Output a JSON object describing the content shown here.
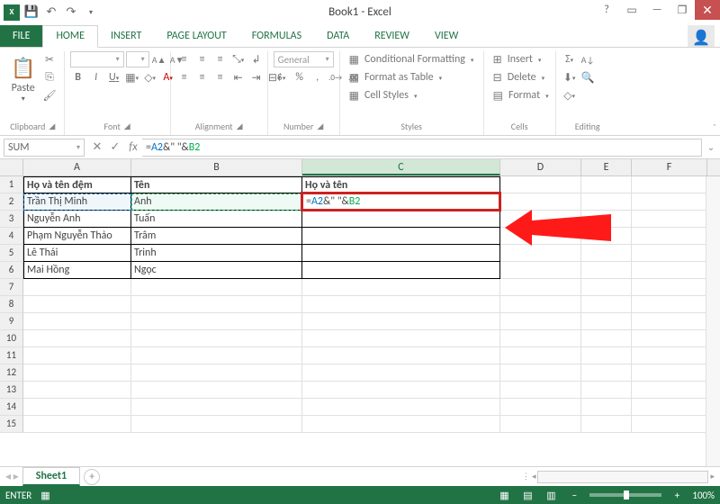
{
  "title": "Book1 - Excel",
  "tabs": {
    "file": "FILE",
    "home": "HOME",
    "insert": "INSERT",
    "pagelayout": "PAGE LAYOUT",
    "formulas": "FORMULAS",
    "data": "DATA",
    "review": "REVIEW",
    "view": "VIEW"
  },
  "ribbon": {
    "clipboard": {
      "paste": "Paste",
      "label": "Clipboard"
    },
    "font": {
      "label": "Font",
      "b": "B",
      "i": "I",
      "u": "U"
    },
    "alignment": {
      "label": "Alignment"
    },
    "number": {
      "label": "Number",
      "format": "General"
    },
    "styles": {
      "label": "Styles",
      "cond": "Conditional Formatting",
      "table": "Format as Table",
      "cell": "Cell Styles"
    },
    "cells": {
      "label": "Cells",
      "insert": "Insert",
      "delete": "Delete",
      "format": "Format"
    },
    "editing": {
      "label": "Editing"
    }
  },
  "namebox": "SUM",
  "formula_parts": {
    "eq": "=",
    "a2": "A2",
    "amp1": "&\" \"&",
    "b2": "B2"
  },
  "columns": [
    "A",
    "B",
    "C",
    "D",
    "E",
    "F"
  ],
  "headers": {
    "A1": "Họ và tên đệm",
    "B1": "Tên",
    "C1": "Họ và tên"
  },
  "data": {
    "A2": "Trần Thị Minh",
    "B2": "Anh",
    "A3": "Nguyễn Anh",
    "B3": "Tuấn",
    "A4": "Phạm Nguyễn Thảo",
    "B4": "Trâm",
    "A5": "Lê Thái",
    "B5": "Trinh",
    "A6": "Mai Hồng",
    "B6": "Ngọc"
  },
  "sheet": "Sheet1",
  "status": "ENTER",
  "zoom": "100%"
}
